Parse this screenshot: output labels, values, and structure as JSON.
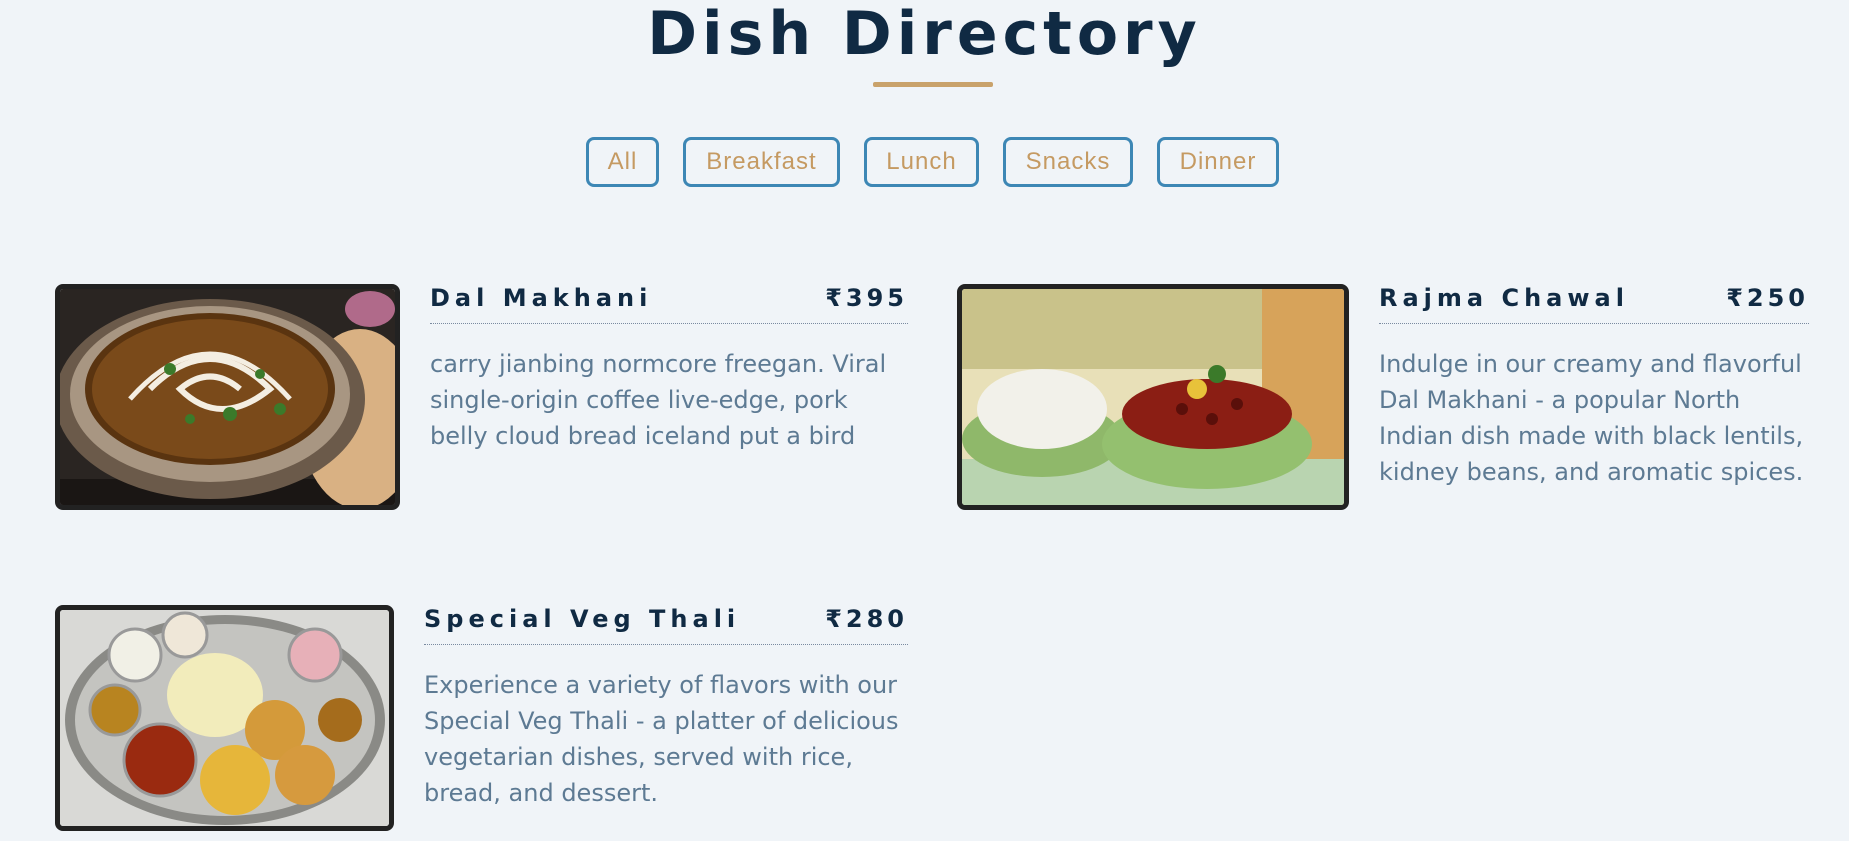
{
  "page": {
    "title": "Dish Directory"
  },
  "filters": [
    "All",
    "Breakfast",
    "Lunch",
    "Snacks",
    "Dinner"
  ],
  "dishes": [
    {
      "name": "Dal Makhani",
      "price": "₹395",
      "description": "carry jianbing normcore freegan. Viral single-origin coffee live-edge, pork belly cloud bread iceland put a bird",
      "image": "dal-makhani-bowl"
    },
    {
      "name": "Rajma Chawal",
      "price": "₹250",
      "description": "Indulge in our creamy and flavorful Dal Makhani - a popular North Indian dish made with black lentils, kidney beans, and aromatic spices.",
      "image": "rajma-chawal-bowls"
    },
    {
      "name": "Special Veg Thali",
      "price": "₹280",
      "description": "Experience a variety of flavors with our Special Veg Thali - a platter of delicious vegetarian dishes, served with rice, bread, and dessert.",
      "image": "veg-thali-platter"
    }
  ],
  "colors": {
    "accent": "#c9a26b",
    "heading": "#102a43",
    "button_border": "#3d87b5",
    "description": "#5d7a93"
  }
}
